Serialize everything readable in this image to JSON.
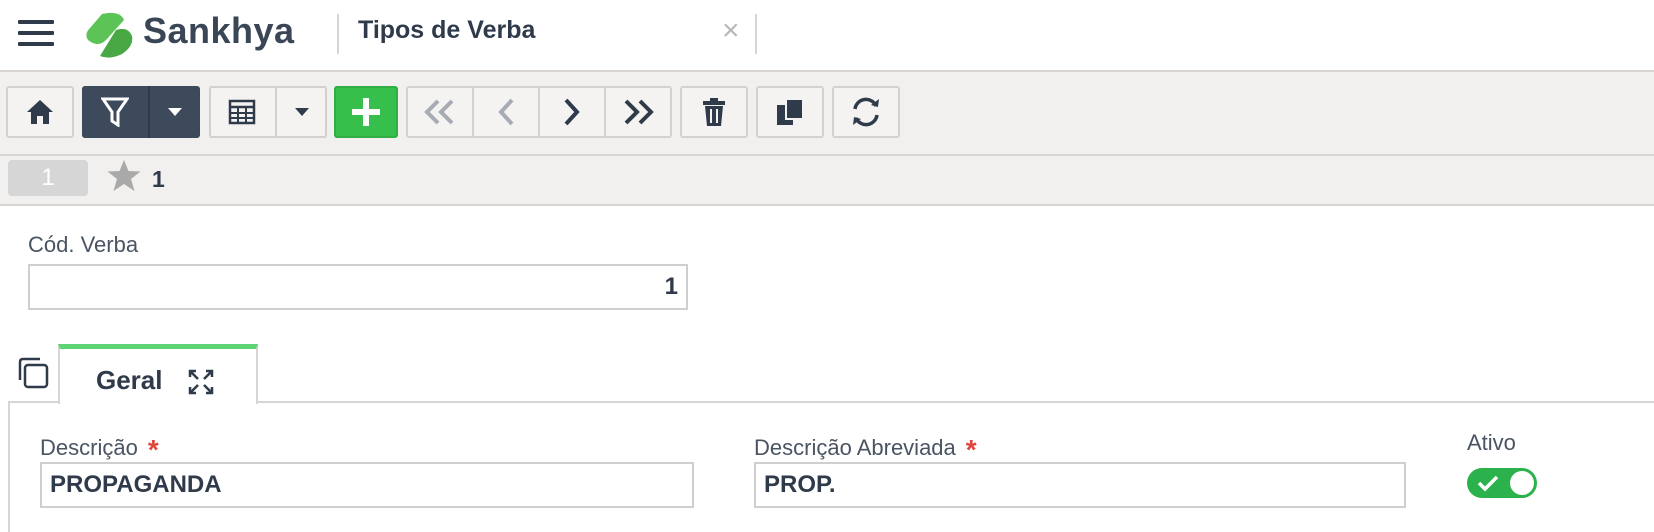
{
  "header": {
    "brand": "Sankhya",
    "title": "Tipos de Verba",
    "close_glyph": "×"
  },
  "toolbar": {
    "buttons": [
      "home-icon",
      "filter-icon",
      "filter-dropdown-icon",
      "grid-icon",
      "grid-dropdown-icon",
      "add-icon",
      "first-record-icon",
      "previous-record-icon",
      "next-record-icon",
      "last-record-icon",
      "delete-icon",
      "duplicate-icon",
      "refresh-icon"
    ],
    "add_color": "#37bf4b"
  },
  "record_bar": {
    "record_number": "1",
    "favorite_count": "1"
  },
  "form": {
    "cod_verba_label": "Cód. Verba",
    "cod_verba_value": "1"
  },
  "tabs": [
    {
      "label": "Geral",
      "active": true
    }
  ],
  "geral": {
    "descricao_label": "Descrição",
    "descricao_value": "PROPAGANDA",
    "descricao_abreviada_label": "Descrição Abreviada",
    "descricao_abreviada_value": "PROP.",
    "required_mark": "*",
    "ativo_label": "Ativo",
    "ativo_value": true
  },
  "colors": {
    "accent_dark": "#3c4a5c",
    "success": "#2bb24c",
    "required": "#e0443a"
  }
}
